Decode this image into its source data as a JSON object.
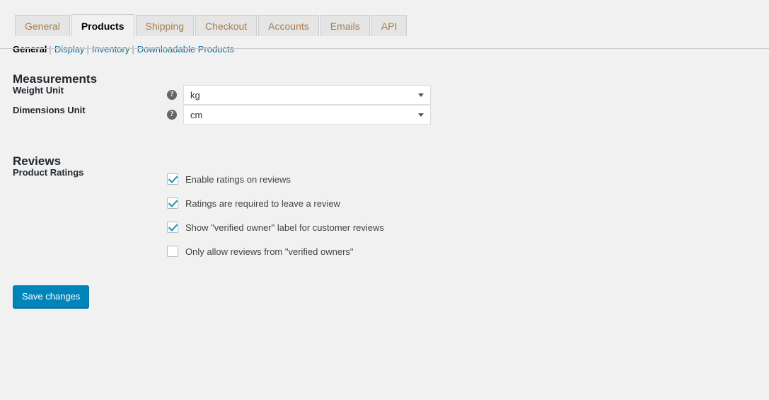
{
  "tabs": [
    {
      "label": "General",
      "active": false
    },
    {
      "label": "Products",
      "active": true
    },
    {
      "label": "Shipping",
      "active": false
    },
    {
      "label": "Checkout",
      "active": false
    },
    {
      "label": "Accounts",
      "active": false
    },
    {
      "label": "Emails",
      "active": false
    },
    {
      "label": "API",
      "active": false
    }
  ],
  "subnav": {
    "items": [
      {
        "label": "General",
        "current": true
      },
      {
        "label": "Display",
        "current": false
      },
      {
        "label": "Inventory",
        "current": false
      },
      {
        "label": "Downloadable Products",
        "current": false
      }
    ],
    "separator": "|"
  },
  "sections": {
    "measurements": {
      "heading": "Measurements",
      "weight_unit": {
        "label": "Weight Unit",
        "help_glyph": "?",
        "value": "kg"
      },
      "dimensions_unit": {
        "label": "Dimensions Unit",
        "help_glyph": "?",
        "value": "cm"
      }
    },
    "reviews": {
      "heading": "Reviews",
      "product_ratings": {
        "label": "Product Ratings",
        "options": [
          {
            "label": "Enable ratings on reviews",
            "checked": true
          },
          {
            "label": "Ratings are required to leave a review",
            "checked": true
          },
          {
            "label": "Show \"verified owner\" label for customer reviews",
            "checked": true
          },
          {
            "label": "Only allow reviews from \"verified owners\"",
            "checked": false
          }
        ]
      }
    }
  },
  "submit": {
    "save_label": "Save changes"
  },
  "colors": {
    "page_background": "#f1f1f1",
    "tab_inactive_background": "#e5e5e5",
    "tab_inactive_text": "#a97c50",
    "link": "#0073aa",
    "checkmark": "#1e8cbe",
    "button_background": "#0085ba",
    "heading": "#23282d"
  }
}
